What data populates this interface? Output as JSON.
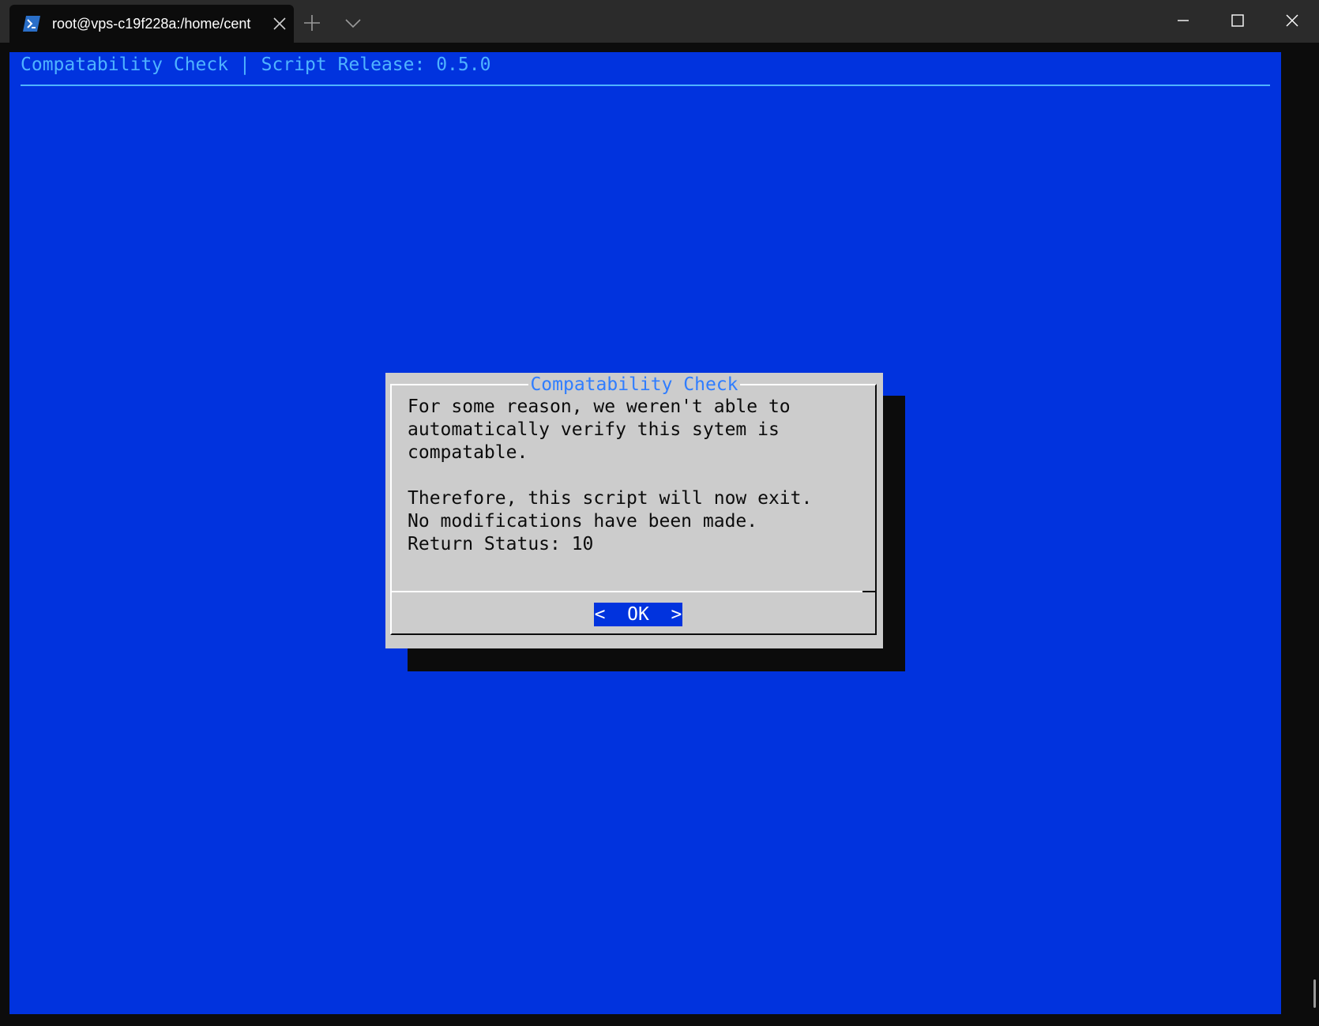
{
  "window": {
    "tab_title": "root@vps-c19f228a:/home/cent",
    "icons": {
      "tab": "powershell-icon",
      "tab_close": "close-icon",
      "new_tab": "plus-icon",
      "dropdown": "chevron-down-icon",
      "minimize": "minimize-icon",
      "maximize": "maximize-icon",
      "close": "close-icon"
    }
  },
  "terminal": {
    "backtitle": "Compatability Check | Script Release: 0.5.0",
    "background_color": "#0133de",
    "accent_color": "#4fb3ff"
  },
  "dialog": {
    "title": "Compatability Check",
    "body": "For some reason, we weren't able to\nautomatically verify this sytem is\ncompatable.\n\nTherefore, this script will now exit.\nNo modifications have been made.\nReturn Status: 10",
    "ok_label": "<  OK  >",
    "title_color": "#2f7dff"
  }
}
